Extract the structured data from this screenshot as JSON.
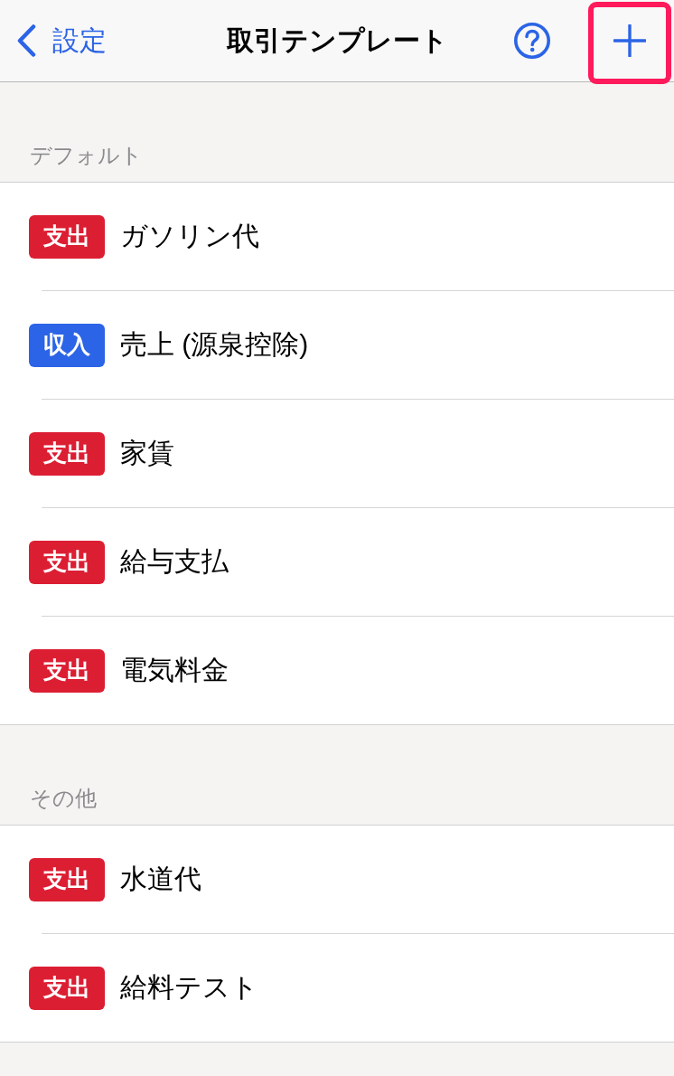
{
  "nav": {
    "back_label": "設定",
    "title": "取引テンプレート",
    "add_button": {
      "highlighted": true
    }
  },
  "sections": [
    {
      "header": "デフォルト",
      "items": [
        {
          "kind": "expense",
          "badge": "支出",
          "name": "ガソリン代"
        },
        {
          "kind": "income",
          "badge": "収入",
          "name": "売上 (源泉控除)"
        },
        {
          "kind": "expense",
          "badge": "支出",
          "name": "家賃"
        },
        {
          "kind": "expense",
          "badge": "支出",
          "name": "給与支払"
        },
        {
          "kind": "expense",
          "badge": "支出",
          "name": "電気料金"
        }
      ]
    },
    {
      "header": "その他",
      "items": [
        {
          "kind": "expense",
          "badge": "支出",
          "name": "水道代"
        },
        {
          "kind": "expense",
          "badge": "支出",
          "name": "給料テスト"
        }
      ]
    }
  ]
}
